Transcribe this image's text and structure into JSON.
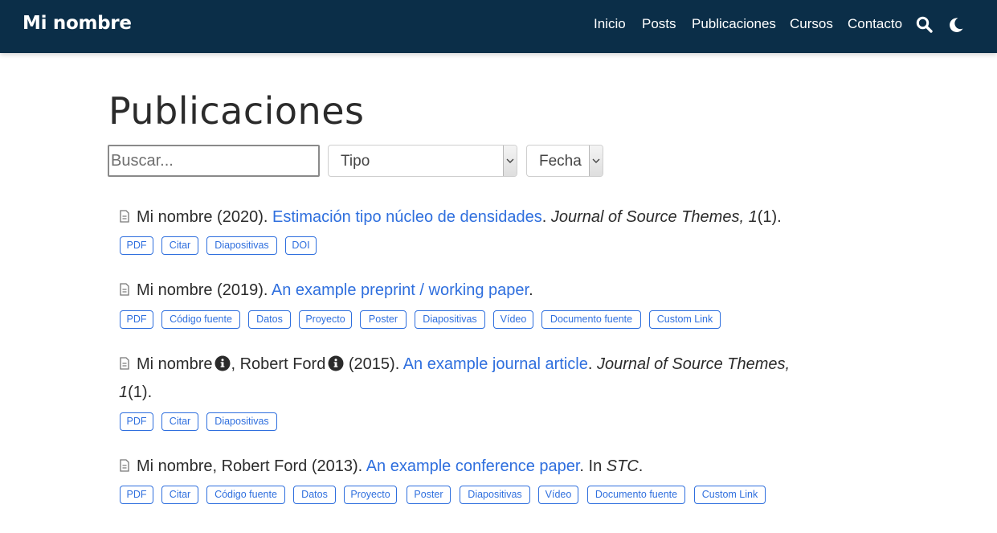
{
  "header": {
    "brand": "Mi nombre",
    "nav": [
      "Inicio",
      "Posts",
      "Publicaciones",
      "Cursos",
      "Contacto"
    ],
    "icons": [
      "search-icon",
      "moon-icon"
    ]
  },
  "page_title": "Publicaciones",
  "filters": {
    "search_placeholder": "Buscar...",
    "type_select": "Tipo",
    "date_select": "Fecha"
  },
  "publications": [
    {
      "authors": "Mi nombre",
      "year": "(2020).",
      "title": "Estimación tipo núcleo de densidades",
      "journal": "Journal of Source Themes, 1",
      "issue": "(1).",
      "buttons": [
        "PDF",
        "Citar",
        "Diapositivas",
        "DOI"
      ]
    },
    {
      "authors": "Mi nombre",
      "year": "(2019).",
      "title": "An example preprint / working paper",
      "buttons": [
        "PDF",
        "Código fuente",
        "Datos",
        "Proyecto",
        "Poster",
        "Diapositivas",
        "Vídeo",
        "Documento fuente",
        "Custom Link"
      ]
    },
    {
      "author1": "Mi nombre",
      "author2": "Robert Ford",
      "year": "(2015).",
      "title": "An example journal article",
      "journal_line1": "Journal of Source Themes,",
      "journal_line2": "1",
      "issue": "(1).",
      "buttons": [
        "PDF",
        "Citar",
        "Diapositivas"
      ]
    },
    {
      "authors": "Mi nombre, Robert Ford",
      "year": "(2013).",
      "title": "An example conference paper",
      "in": "In",
      "venue": "STC",
      "buttons": [
        "PDF",
        "Citar",
        "Código fuente",
        "Datos",
        "Proyecto",
        "Poster",
        "Diapositivas",
        "Vídeo",
        "Documento fuente",
        "Custom Link"
      ]
    }
  ],
  "colors": {
    "navbar": "#0b2e48",
    "link": "#2f6fde",
    "text": "#2b2b2b"
  }
}
